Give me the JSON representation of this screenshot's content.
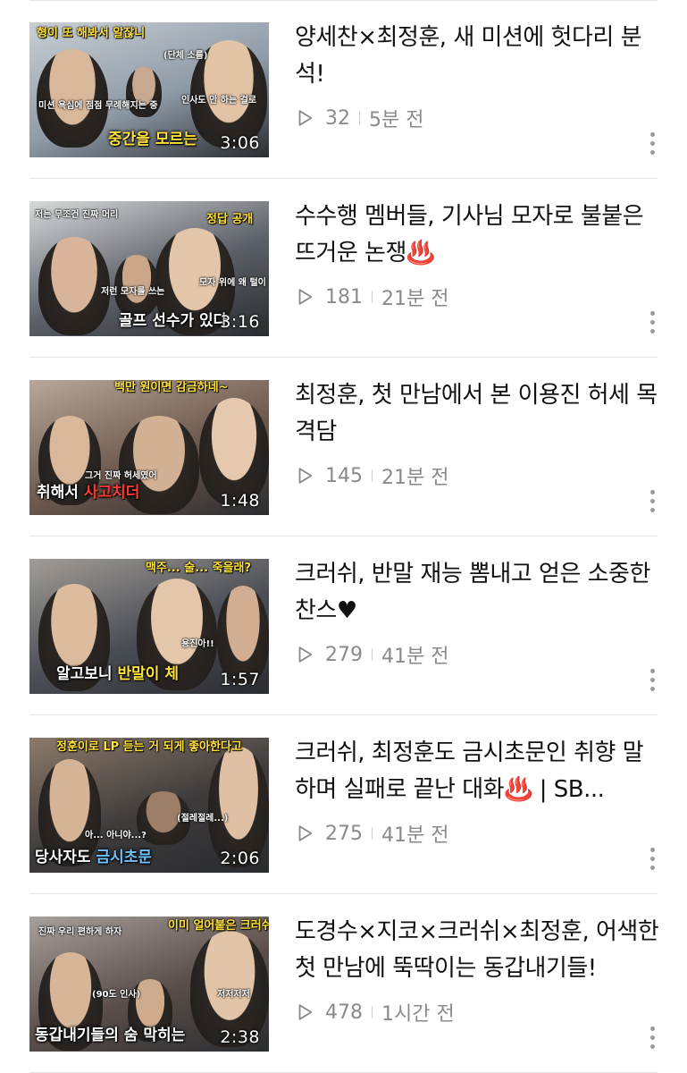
{
  "videos": [
    {
      "title": "양세찬×최정훈, 새 미션에 헛다리 분석!",
      "views": "32",
      "time_ago": "5분 전",
      "duration": "3:06",
      "thumb_top": "형이 또 해봐서 알잖니",
      "thumb_mid": "(단체 소름)",
      "thumb_small_a": "미션 욕심에 점점 무례해지는 중",
      "thumb_small_b": "인사도 안 하는 걸로",
      "thumb_bottom": "중간을 모르는 ",
      "thumb_bottom_hl": "",
      "colors": {
        "bg1": "#8e9aa6",
        "bg2": "#c9cfd4",
        "bottom_color": "#ffe23b"
      }
    },
    {
      "title": "수수행 멤버들, 기사님 모자로 불붙은 뜨거운 논쟁♨️",
      "views": "181",
      "time_ago": "21분 전",
      "duration": "3:16",
      "thumb_top": "정답 공개",
      "thumb_mid": "저는 무조건 진짜 머리",
      "thumb_small_a": "저런 모자를 쓰는",
      "thumb_small_b": "모자 위에 왜 털이 있나고!",
      "thumb_bottom": "골프 선수가 있다 ",
      "thumb_bottom_hl": "",
      "colors": {
        "bg1": "#5c6068",
        "bg2": "#d7d9dc",
        "bottom_color": "#ffffff"
      }
    },
    {
      "title": "최정훈, 첫 만남에서 본 이용진 허세 목격담",
      "views": "145",
      "time_ago": "21분 전",
      "duration": "1:48",
      "thumb_top": "백만 원이면 감금하네~",
      "thumb_mid": "그거 진짜 허세였어",
      "thumb_small_a": "",
      "thumb_small_b": "",
      "thumb_bottom": "취해서 ",
      "thumb_bottom_hl": "사고치더",
      "colors": {
        "bg1": "#6e5a4e",
        "bg2": "#b8a79a",
        "bottom_color": "#ff3b30"
      }
    },
    {
      "title": "크러쉬, 반말 재능 뽐내고 얻은 소중한 찬스♥",
      "views": "279",
      "time_ago": "41분 전",
      "duration": "1:57",
      "thumb_top": "맥주... 술... 죽을래?",
      "thumb_mid": "용진아!!",
      "thumb_small_a": "",
      "thumb_small_b": "",
      "thumb_bottom": "알고보니 ",
      "thumb_bottom_hl": "반말이 체",
      "colors": {
        "bg1": "#4a4d55",
        "bg2": "#a29c96",
        "bottom_color": "#ffe23b"
      }
    },
    {
      "title": "크러쉬, 최정훈도 금시초문인 취향 말하며 실패로 끝난 대화♨️ | SB...",
      "views": "275",
      "time_ago": "41분 전",
      "duration": "2:06",
      "thumb_top": "정훈이로 LP 듣는 거 되게 좋아한다고",
      "thumb_mid": "(절레절레...)",
      "thumb_small_a": "아... 아니야...?",
      "thumb_small_b": "",
      "thumb_bottom": "당사자도 ",
      "thumb_bottom_hl": "금시초문",
      "colors": {
        "bg1": "#3d3a3a",
        "bg2": "#8c7a6a",
        "bottom_color": "#6ec3ff"
      }
    },
    {
      "title": "도경수×지코×크러쉬×최정훈, 어색한 첫 만남에 뚝딱이는 동갑내기들!",
      "views": "478",
      "time_ago": "1시간 전",
      "duration": "2:38",
      "thumb_top": "이미 얼어붙은 크러쉬",
      "thumb_mid": "(90도 인사)",
      "thumb_small_a": "진짜 우리 편하게 하자",
      "thumb_small_b": "저저저저",
      "thumb_bottom": "동갑내기들의 숨 막히는 ",
      "thumb_bottom_hl": "",
      "colors": {
        "bg1": "#5a4e4a",
        "bg2": "#a8a09a",
        "bottom_color": "#ffffff"
      }
    }
  ],
  "icons": {
    "play": "play-outline-icon",
    "more": "more-vertical-icon"
  }
}
